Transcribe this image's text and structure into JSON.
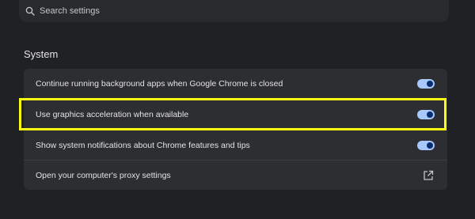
{
  "search": {
    "placeholder": "Search settings",
    "icon": "search-icon"
  },
  "section": {
    "title": "System"
  },
  "settings": [
    {
      "label": "Continue running background apps when Google Chrome is closed",
      "control": "toggle",
      "enabled": true
    },
    {
      "label": "Use graphics acceleration when available",
      "control": "toggle",
      "enabled": true,
      "highlighted": true
    },
    {
      "label": "Show system notifications about Chrome features and tips",
      "control": "toggle",
      "enabled": true
    },
    {
      "label": "Open your computer's proxy settings",
      "control": "external-link",
      "icon": "open-in-new-icon"
    }
  ],
  "colors": {
    "background": "#202124",
    "card": "#2d2e31",
    "toggle_track": "#a8c7fa",
    "toggle_knob": "#062e6f",
    "highlight": "#fbff11"
  }
}
